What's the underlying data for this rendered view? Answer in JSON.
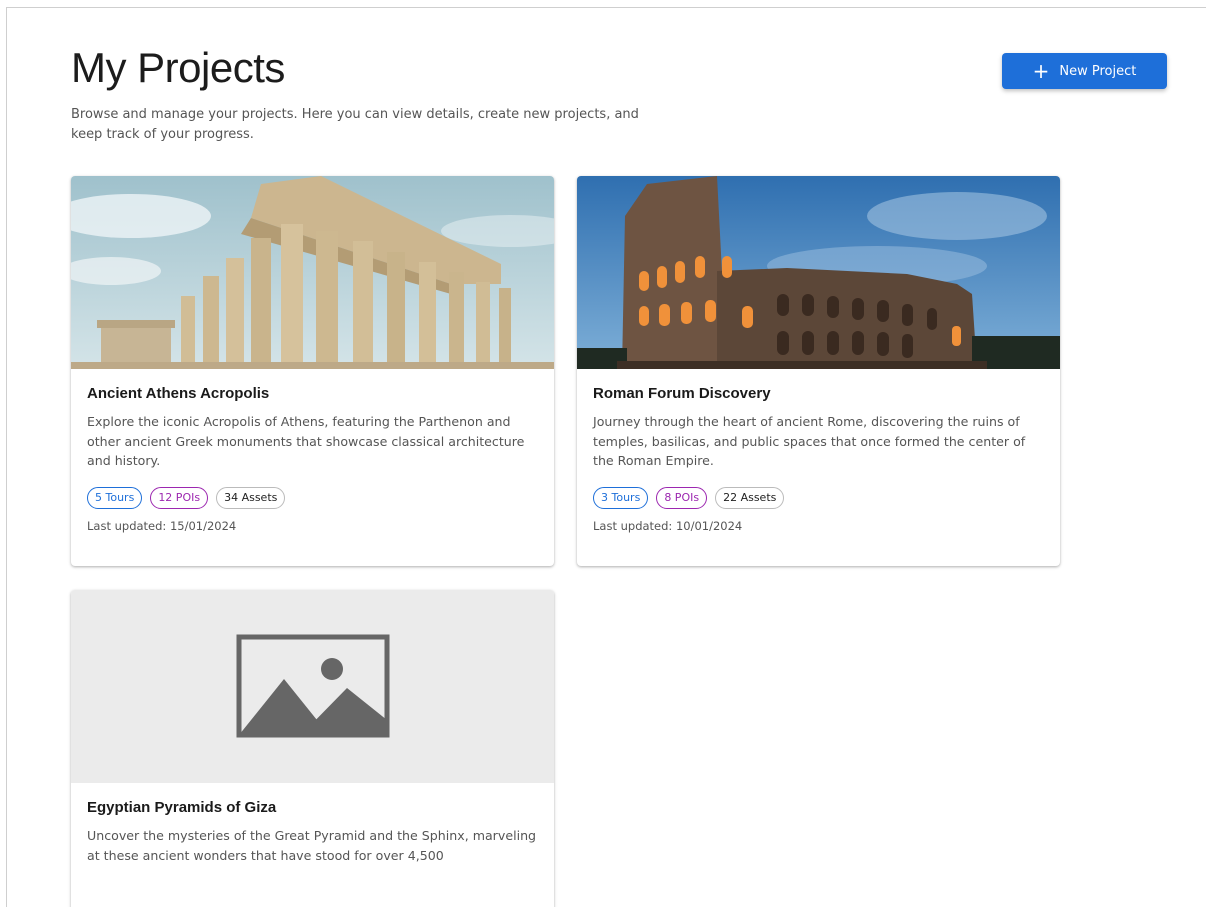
{
  "header": {
    "title": "My Projects",
    "description": "Browse and manage your projects. Here you can view details, create new projects, and keep track of your progress.",
    "new_project_label": "New Project",
    "new_project_icon": "plus-icon"
  },
  "colors": {
    "primary": "#1e6fd9",
    "tours_chip": "#1e6fd9",
    "pois_chip": "#9c27b0",
    "placeholder_bg": "#ebebeb",
    "placeholder_icon": "#666666"
  },
  "projects": [
    {
      "title": "Ancient Athens Acropolis",
      "description": "Explore the iconic Acropolis of Athens, featuring the Parthenon and other ancient Greek monuments that showcase classical architecture and history.",
      "tours": "5 Tours",
      "pois": "12 POIs",
      "assets": "34 Assets",
      "updated": "Last updated: 15/01/2024"
    },
    {
      "title": "Roman Forum Discovery",
      "description": "Journey through the heart of ancient Rome, discovering the ruins of temples, basilicas, and public spaces that once formed the center of the Roman Empire.",
      "tours": "3 Tours",
      "pois": "8 POIs",
      "assets": "22 Assets",
      "updated": "Last updated: 10/01/2024"
    },
    {
      "title": "Egyptian Pyramids of Giza",
      "description": "Uncover the mysteries of the Great Pyramid and the Sphinx, marveling at these ancient wonders that have stood for over 4,500"
    }
  ]
}
